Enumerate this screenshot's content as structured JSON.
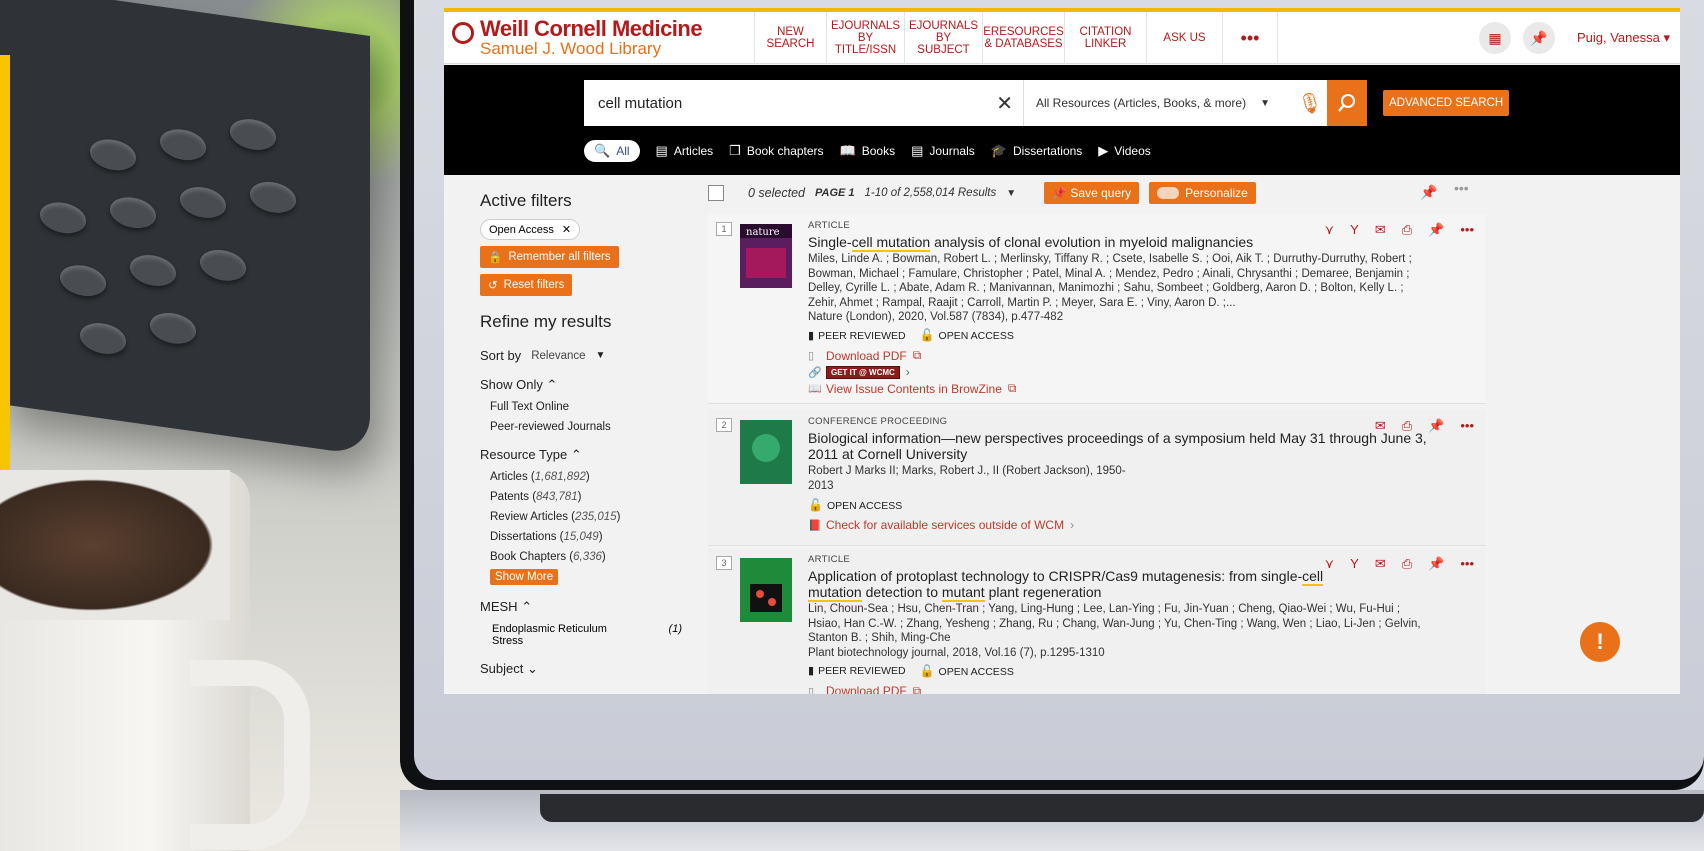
{
  "header": {
    "logo_name": "Weill Cornell Medicine",
    "logo_sub": "Samuel J. Wood Library",
    "nav": {
      "new_search": "NEW SEARCH",
      "ejournals_title": "EJOURNALS BY TITLE/ISSN",
      "ejournals_subject": "EJOURNALS BY SUBJECT",
      "eresources": "ERESOURCES & DATABASES",
      "citation_linker": "CITATION LINKER",
      "ask_us": "ASK US",
      "more": "•••"
    },
    "user": "Puig, Vanessa"
  },
  "search": {
    "query": "cell mutation",
    "scope": "All Resources (Articles, Books, & more)",
    "advanced": "ADVANCED SEARCH"
  },
  "type_tabs": {
    "all": "All",
    "articles": "Articles",
    "book_chapters": "Book chapters",
    "books": "Books",
    "journals": "Journals",
    "dissertations": "Dissertations",
    "videos": "Videos"
  },
  "filters": {
    "active_title": "Active filters",
    "active_chip": "Open Access",
    "remember": "Remember all filters",
    "reset": "Reset filters",
    "refine_title": "Refine my results",
    "sort_label": "Sort by",
    "sort_value": "Relevance",
    "show_only": {
      "title": "Show Only",
      "items": [
        "Full Text Online",
        "Peer-reviewed Journals"
      ]
    },
    "resource_type": {
      "title": "Resource Type",
      "items": [
        {
          "label": "Articles",
          "count": "1,681,892"
        },
        {
          "label": "Patents",
          "count": "843,781"
        },
        {
          "label": "Review Articles",
          "count": "235,015"
        },
        {
          "label": "Dissertations",
          "count": "15,049"
        },
        {
          "label": "Book Chapters",
          "count": "6,336"
        }
      ],
      "show_more": "Show More"
    },
    "mesh": {
      "title": "MESH",
      "item_label": "Endoplasmic Reticulum Stress",
      "item_count": "1"
    },
    "subject_title": "Subject"
  },
  "results_bar": {
    "selected": "0 selected",
    "page": "PAGE 1",
    "range": "1-10 of 2,558,014 Results",
    "save_query": "Save query",
    "personalize": "Personalize"
  },
  "results": [
    {
      "num": "1",
      "type": "ARTICLE",
      "title_a": "Single-",
      "title_hl": "cell mutation",
      "title_b": " analysis of clonal evolution in myeloid malignancies",
      "authors": "Miles, Linde A. ; Bowman, Robert L. ; Merlinsky, Tiffany R. ; Csete, Isabelle S. ; Ooi, Aik T. ; Durruthy-Durruthy, Robert ; Bowman, Michael ; Famulare, Christopher ; Patel, Minal A. ; Mendez, Pedro ; Ainali, Chrysanthi ; Demaree, Benjamin ; Delley, Cyrille L. ; Abate, Adam R. ; Manivannan, Manimozhi ; Sahu, Sombeet ; Goldberg, Aaron D. ; Bolton, Kelly L. ; Zehir, Ahmet ; Rampal, Raajit ; Carroll, Martin P. ; Meyer, Sara E. ; Viny, Aaron D. ;...",
      "source": "Nature (London), 2020, Vol.587 (7834), p.477-482",
      "peer": "PEER REVIEWED",
      "oa": "OPEN ACCESS",
      "download": "Download PDF",
      "getit": "GET IT @ WCMC",
      "browzine": "View Issue Contents in BrowZine",
      "thumb_color": "#6a2a6a"
    },
    {
      "num": "2",
      "type": "CONFERENCE PROCEEDING",
      "title": "Biological information—new perspectives proceedings of a symposium held May 31 through June 3, 2011 at Cornell University",
      "authors": "Robert J Marks II; Marks, Robert J., II (Robert Jackson), 1950-2013",
      "oa": "OPEN ACCESS",
      "services": "Check for available services outside of WCM",
      "thumb_color": "#1f7a4a"
    },
    {
      "num": "3",
      "type": "ARTICLE",
      "title_a": "Application of protoplast technology to CRISPR/Cas9 mutagenesis: from single-",
      "title_hl": "cell mutation",
      "title_b": " detection to ",
      "title_hl2": "mutant",
      "title_c": " plant regeneration",
      "authors": "Lin, Choun-Sea ; Hsu, Chen-Tran ; Yang, Ling-Hung ; Lee, Lan-Ying ; Fu, Jin-Yuan ; Cheng, Qiao-Wei ; Wu, Fu-Hui ; Hsiao, Han C.-W. ; Zhang, Yesheng ; Zhang, Ru ; Chang, Wan-Jung ; Yu, Chen-Ting ; Wang, Wen ; Liao, Li-Jen ; Gelvin, Stanton B. ; Shih, Ming-Che",
      "source": "Plant biotechnology journal, 2018, Vol.16 (7), p.1295-1310",
      "peer": "PEER REVIEWED",
      "oa": "OPEN ACCESS",
      "download": "Download PDF",
      "thumb_color": "#1e8a3a"
    }
  ],
  "feedback": "!",
  "colors": {
    "accent": "#e8711a",
    "brand": "#b31b1b"
  }
}
